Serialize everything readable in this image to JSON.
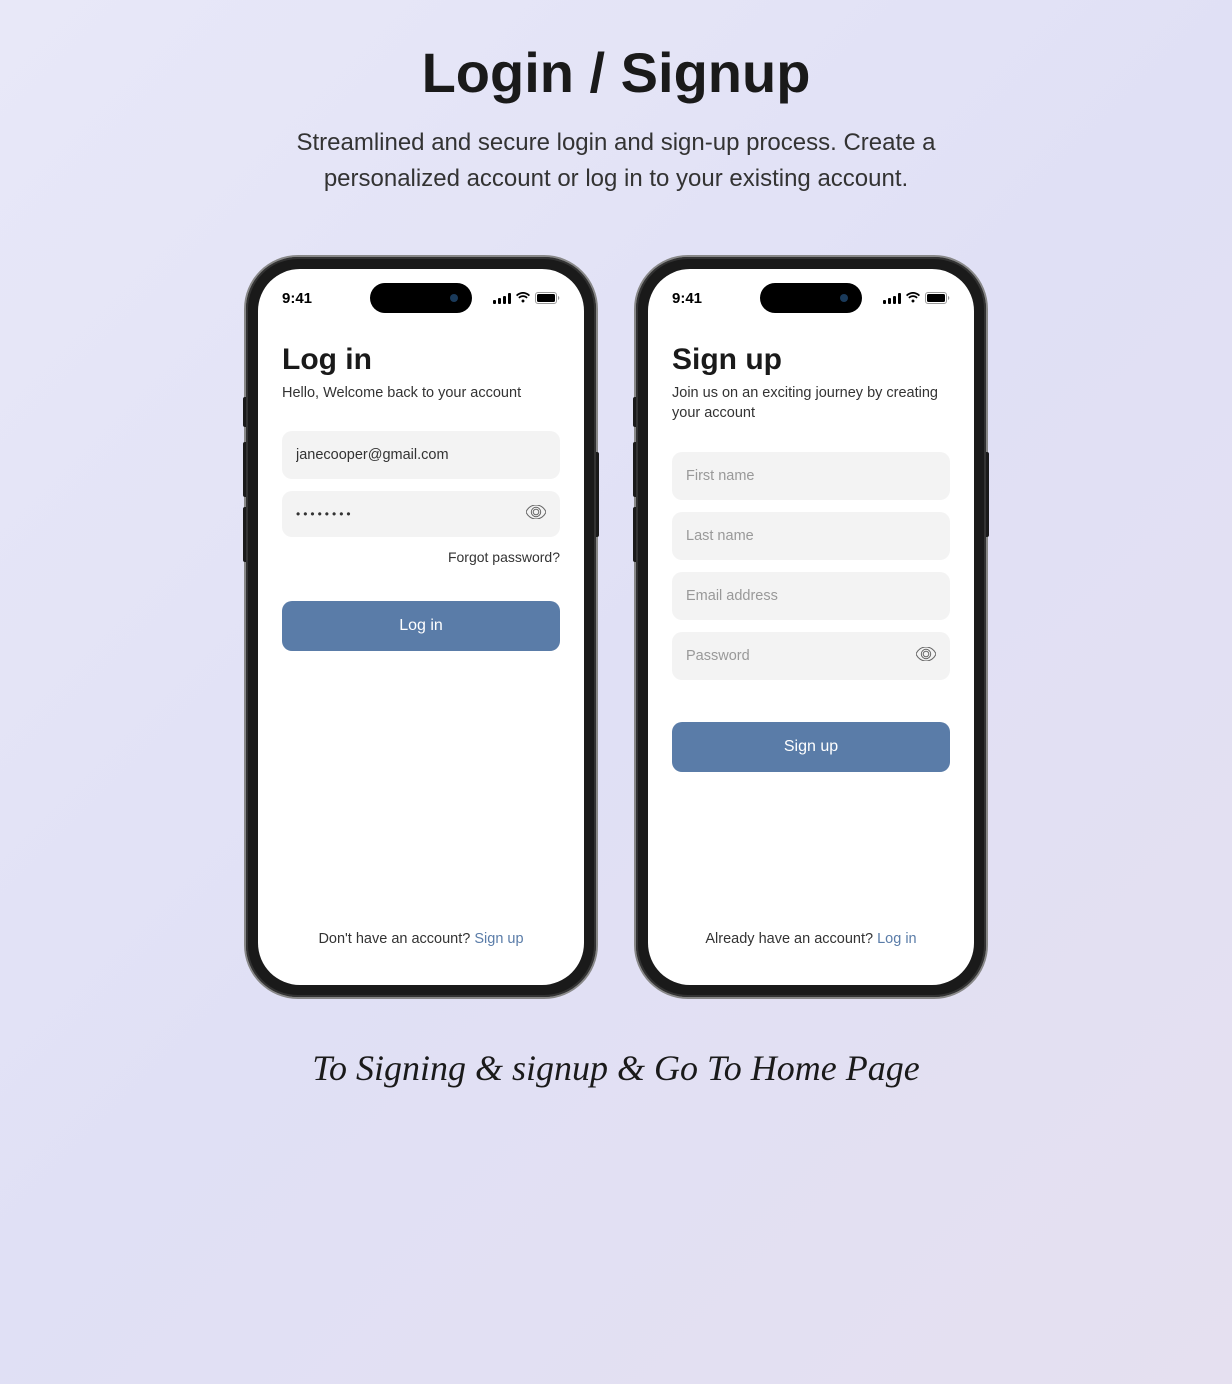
{
  "page": {
    "title": "Login / Signup",
    "subtitle": "Streamlined and secure login and sign-up process. Create a personalized account or log in to your existing account.",
    "bottom_caption": "To Signing & signup & Go To Home Page"
  },
  "status": {
    "time": "9:41"
  },
  "login": {
    "title": "Log in",
    "subtitle": "Hello, Welcome back to your account",
    "email_value": "janecooper@gmail.com",
    "password_value": "••••••••",
    "forgot_label": "Forgot password?",
    "button_label": "Log in",
    "footer_text": "Don't have an account? ",
    "footer_link": "Sign up"
  },
  "signup": {
    "title": "Sign up",
    "subtitle": "Join us on an exciting journey by creating your account",
    "firstname_placeholder": "First name",
    "lastname_placeholder": "Last name",
    "email_placeholder": "Email address",
    "password_placeholder": "Password",
    "button_label": "Sign up",
    "footer_text": "Already have an account? ",
    "footer_link": "Log in"
  }
}
